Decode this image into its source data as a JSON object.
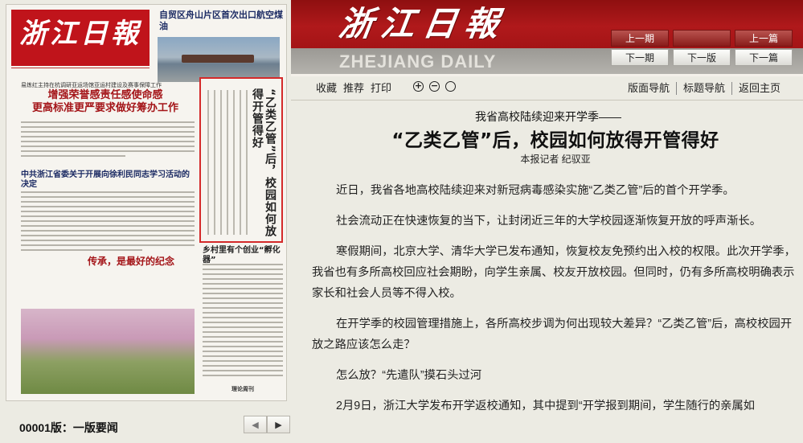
{
  "thumbnail": {
    "masthead": "浙江日報",
    "top_headline": "自贸区舟山片区首次出口航空煤油",
    "headlines": [
      "易炼红主持在杭调研亚运场馆亚运村建设及赛事保障工作",
      "增强荣誉感责任感使命感",
      "更高标准更严要求做好筹办工作",
      "中共浙江省委关于开展向徐利民同志学习活动的决定",
      "传承，是最好的纪念",
      "乡村里有个创业“孵化器”"
    ],
    "highlight_title": "“乙类乙管”后，校园如何放得开管得好",
    "ad_label": "理论周刊"
  },
  "page_caption": "00001版：一版要闻",
  "pager": {
    "prev": "◀",
    "next": "▶"
  },
  "header": {
    "logo": "浙江日報",
    "logo_en": "ZHEJIANG DAILY",
    "nav": [
      {
        "label": "上一期",
        "style": "dark"
      },
      {
        "label": "",
        "style": "dark"
      },
      {
        "label": "上一篇",
        "style": "dark"
      },
      {
        "label": "下一期",
        "style": "light"
      },
      {
        "label": "下一版",
        "style": "light"
      },
      {
        "label": "下一篇",
        "style": "light"
      }
    ]
  },
  "toolbar": {
    "favorite": "收藏",
    "recommend": "推荐",
    "print": "打印",
    "zoom_in": "+",
    "zoom_out": "−",
    "zoom_reset": "",
    "layout_nav": "版面导航",
    "title_nav": "标题导航",
    "home": "返回主页"
  },
  "article": {
    "kicker": "我省高校陆续迎来开学季——",
    "headline": "“乙类乙管”后，校园如何放得开管得好",
    "byline": "本报记者 纪驭亚",
    "paragraphs": [
      "近日，我省各地高校陆续迎来对新冠病毒感染实施“乙类乙管”后的首个开学季。",
      "社会流动正在快速恢复的当下，让封闭近三年的大学校园逐渐恢复开放的呼声渐长。",
      "寒假期间，北京大学、清华大学已发布通知，恢复校友免预约出入校的权限。此次开学季，我省也有多所高校回应社会期盼，向学生亲属、校友开放校园。但同时，仍有多所高校明确表示家长和社会人员等不得入校。",
      "在开学季的校园管理措施上，各所高校步调为何出现较大差异？“乙类乙管”后，高校校园开放之路应该怎么走？",
      "怎么放？“先遣队”摸石头过河",
      "2月9日，浙江大学发布开学返校通知，其中提到“开学报到期间，学生随行的亲属如"
    ]
  }
}
